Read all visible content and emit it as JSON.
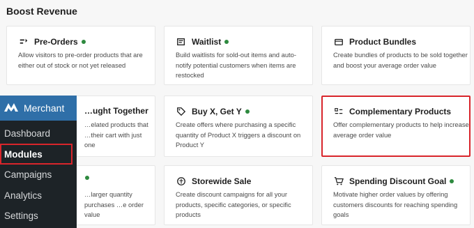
{
  "section": {
    "title": "Boost Revenue"
  },
  "colors": {
    "active_dot": "#2e8a3f",
    "highlight": "#d9252b",
    "sidebar_bg": "#1d2327",
    "brand_bg": "#2f6fa8"
  },
  "cards": [
    {
      "title": "Pre-Orders",
      "icon": "pre-orders-icon",
      "active": true,
      "desc": "Allow visitors to pre-order products that are either out of stock or not yet released"
    },
    {
      "title": "Waitlist",
      "icon": "waitlist-icon",
      "active": true,
      "desc": "Build waitlists for sold-out items and auto-notify potential customers when items are restocked"
    },
    {
      "title": "Product Bundles",
      "icon": "bundle-icon",
      "active": false,
      "desc": "Create bundles of products to be sold together and boost your average order value"
    },
    {
      "title": "…ught Together",
      "icon": "",
      "active": false,
      "desc": "…elated products that …their cart with just one"
    },
    {
      "title": "Buy X, Get Y",
      "icon": "tag-icon",
      "active": true,
      "desc": "Create offers where purchasing a specific quantity of Product X triggers a discount on Product Y"
    },
    {
      "title": "Complementary Products",
      "icon": "complementary-icon",
      "active": false,
      "desc": "Offer complementary products to help increase average order value"
    },
    {
      "title": "",
      "icon": "",
      "active": true,
      "desc": "…larger quantity purchases …e order value"
    },
    {
      "title": "Storewide Sale",
      "icon": "sale-icon",
      "active": false,
      "desc": "Create discount campaigns for all your products, specific categories, or specific products"
    },
    {
      "title": "Spending Discount Goal",
      "icon": "cart-icon",
      "active": true,
      "desc": "Motivate higher order values by offering customers discounts for reaching spending goals"
    }
  ],
  "sidebar": {
    "brand": "Merchant",
    "items": [
      "Dashboard",
      "Modules",
      "Campaigns",
      "Analytics",
      "Settings"
    ],
    "active": "Modules"
  }
}
